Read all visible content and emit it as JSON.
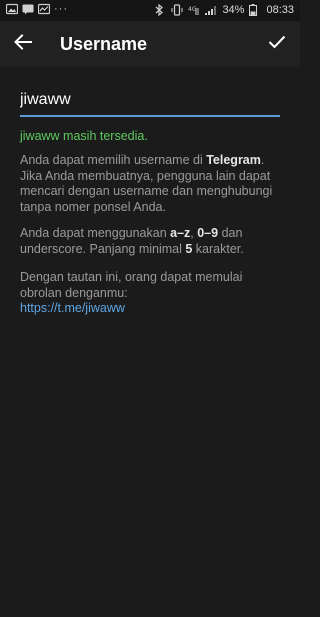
{
  "status_bar": {
    "dots": "···",
    "battery": "34%",
    "time": "08:33",
    "network": "4G",
    "icons": [
      "gallery-icon",
      "message-icon",
      "graph-icon",
      "bluetooth-icon",
      "vibrate-icon",
      "network-4g-icon",
      "signal-icon",
      "battery-icon"
    ]
  },
  "app_bar": {
    "title": "Username",
    "back_icon": "arrow-left-icon",
    "done_icon": "checkmark-icon"
  },
  "form": {
    "username_value": "jiwaww",
    "accent": "#5c9ad6"
  },
  "status": {
    "available_text": "jiwaww masih tersedia.",
    "color": "#5fc95f"
  },
  "info": {
    "p1_a": "Anda dapat memilih username di ",
    "p1_b": "Telegram",
    "p1_c": ". Jika Anda membuatnya, pengguna lain dapat mencari dengan username dan menghubungi tanpa nomer ponsel Anda.",
    "p2_a": "Anda dapat menggunakan ",
    "p2_b": "a–z",
    "p2_c": ", ",
    "p2_d": "0–9",
    "p2_e": " dan underscore. Panjang minimal ",
    "p2_f": "5",
    "p2_g": " karakter.",
    "p3_a": "Dengan tautan ini, orang dapat memulai obrolan denganmu:",
    "link": "https://t.me/jiwaww"
  }
}
